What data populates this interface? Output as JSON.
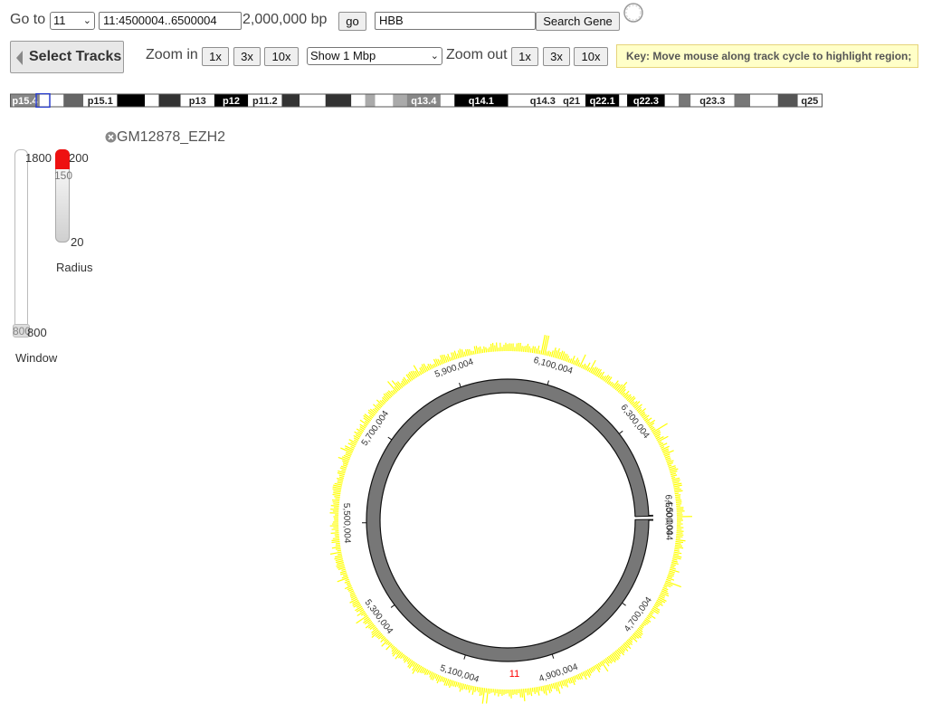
{
  "goto": {
    "label": "Go to",
    "chromosome": "11",
    "position": "11:4500004..6500004",
    "span": "2,000,000 bp",
    "go_label": "go"
  },
  "gene_search": {
    "value": "HBB",
    "button": "Search Gene"
  },
  "loading_icon": "spinner-icon",
  "select_tracks": "Select Tracks",
  "zoom_in": {
    "label": "Zoom in",
    "buttons": [
      "1x",
      "3x",
      "10x"
    ]
  },
  "show_select": "Show 1 Mbp",
  "zoom_out": {
    "label": "Zoom out",
    "buttons": [
      "1x",
      "3x",
      "10x"
    ]
  },
  "key": "Key: Move mouse along track cycle to highlight region;",
  "ideogram": {
    "bands": [
      {
        "label": "p15.4",
        "color": "#888888"
      },
      {
        "label": "",
        "color": "#ffffff"
      },
      {
        "label": "",
        "color": "#666666"
      },
      {
        "label": "p15.1",
        "color": "#ffffff"
      },
      {
        "label": "",
        "color": "#000000"
      },
      {
        "label": "",
        "color": "#ffffff"
      },
      {
        "label": "",
        "color": "#333333"
      },
      {
        "label": "p13",
        "color": "#ffffff"
      },
      {
        "label": "p12",
        "color": "#000000"
      },
      {
        "label": "p11.2",
        "color": "#ffffff"
      },
      {
        "label": "",
        "color": "#333333"
      },
      {
        "label": "",
        "color": "#ffffff"
      },
      {
        "label": "",
        "color": "#333333"
      },
      {
        "label": "",
        "color": "#ffffff"
      },
      {
        "label": "",
        "color": "#aaaaaa"
      },
      {
        "label": "",
        "color": "#ffffff"
      },
      {
        "label": "",
        "color": "#aaaaaa"
      },
      {
        "label": "q13.4",
        "color": "#888888"
      },
      {
        "label": "",
        "color": "#ffffff"
      },
      {
        "label": "q14.1",
        "color": "#000000"
      },
      {
        "label": "",
        "color": "#ffffff"
      },
      {
        "label": "q14.3",
        "color": "#ffffff"
      },
      {
        "label": "q21",
        "color": "#ffffff"
      },
      {
        "label": "q22.1",
        "color": "#000000"
      },
      {
        "label": "",
        "color": "#ffffff"
      },
      {
        "label": "q22.3",
        "color": "#000000"
      },
      {
        "label": "",
        "color": "#ffffff"
      },
      {
        "label": "",
        "color": "#777777"
      },
      {
        "label": "q23.3",
        "color": "#ffffff"
      },
      {
        "label": "",
        "color": "#777777"
      },
      {
        "label": "",
        "color": "#ffffff"
      },
      {
        "label": "",
        "color": "#555555"
      },
      {
        "label": "q25",
        "color": "#ffffff"
      }
    ]
  },
  "track_name": "GM12878_EZH2",
  "window_slider": {
    "max": "1800",
    "min": "800",
    "handle": "800",
    "label": "Window"
  },
  "radius_slider": {
    "max": "200",
    "handle": "150",
    "min": "20",
    "label": "Radius"
  },
  "circos": {
    "chromosome_label": "11",
    "ticks": [
      {
        "label": "4,500,004",
        "pos": 4500004
      },
      {
        "label": "4,700,004",
        "pos": 4700004
      },
      {
        "label": "4,900,004",
        "pos": 4900004
      },
      {
        "label": "5,100,004",
        "pos": 5100004
      },
      {
        "label": "5,300,004",
        "pos": 5300004
      },
      {
        "label": "5,500,004",
        "pos": 5500004
      },
      {
        "label": "5,700,004",
        "pos": 5700004
      },
      {
        "label": "5,900,004",
        "pos": 5900004
      },
      {
        "label": "6,100,004",
        "pos": 6100004
      },
      {
        "label": "6,300,004",
        "pos": 6300004
      },
      {
        "label": "6,500,004",
        "pos": 6500004
      }
    ],
    "range": [
      4500004,
      6500004
    ],
    "ring_color": "#777777",
    "signal_color": "#ffff00",
    "chrom_label_color": "#ff0000"
  }
}
